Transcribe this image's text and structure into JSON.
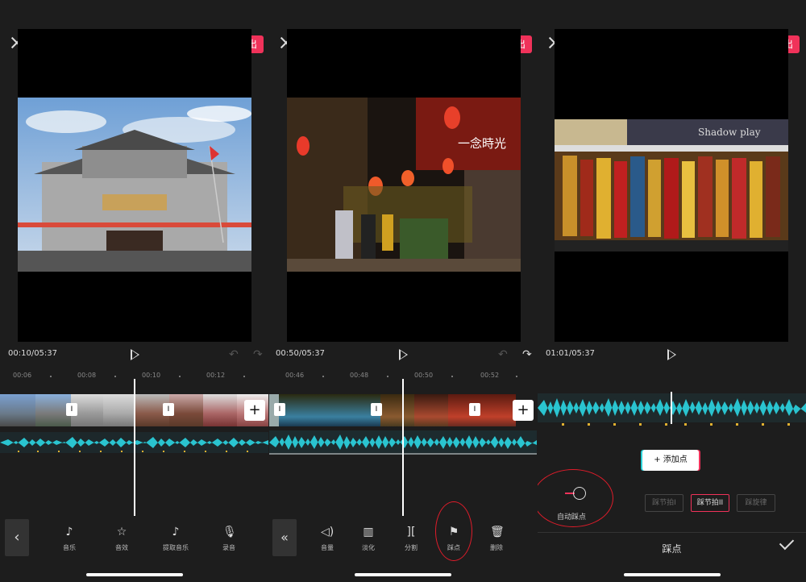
{
  "panels": [
    {
      "export_label": "导出",
      "time": "00:10/05:37",
      "ticks": [
        "00:06",
        "00:08",
        "00:10",
        "00:12"
      ],
      "tools": [
        {
          "icon": "music-icon",
          "label": "音乐"
        },
        {
          "icon": "sound-effect-icon",
          "label": "音效"
        },
        {
          "icon": "tiktok-icon",
          "label": "提取音乐"
        },
        {
          "icon": "mic-icon",
          "label": "录音"
        }
      ]
    },
    {
      "export_label": "导出",
      "time": "00:50/05:37",
      "ticks": [
        "00:46",
        "00:48",
        "00:50",
        "00:52"
      ],
      "photo_text": "一念時光",
      "tools": [
        {
          "icon": "volume-icon",
          "label": "音量"
        },
        {
          "icon": "fade-icon",
          "label": "淡化"
        },
        {
          "icon": "split-icon",
          "label": "分割"
        },
        {
          "icon": "flag-icon",
          "label": "踩点"
        },
        {
          "icon": "delete-icon",
          "label": "删除"
        }
      ]
    },
    {
      "export_label": "导出",
      "time": "01:01/05:37",
      "photo_text": "Shadow play",
      "add_point_label": "+ 添加点",
      "auto_beat_label": "自动踩点",
      "beat_options": [
        "踩节拍I",
        "踩节拍II",
        "踩旋律"
      ],
      "active_beat_option": 1,
      "sheet_title": "踩点"
    }
  ],
  "colors": {
    "accent": "#f0325a",
    "waveform": "#2ac4d0",
    "annotation_ring": "#e01c2a"
  }
}
